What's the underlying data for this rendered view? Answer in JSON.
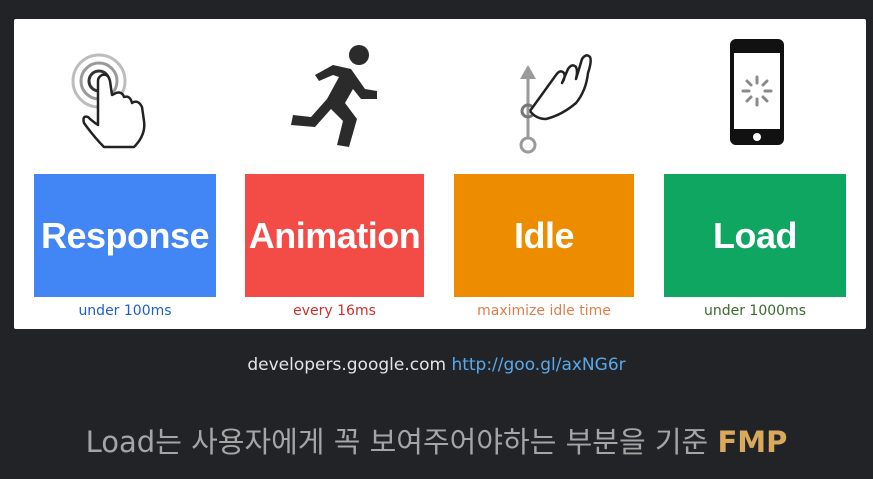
{
  "cards": [
    {
      "title": "Response",
      "subtitle": "under 100ms",
      "color": "#4286f5",
      "label_color": "#1f5fc4",
      "icon": "touch-hand-icon"
    },
    {
      "title": "Animation",
      "subtitle": "every 16ms",
      "color": "#f34b46",
      "label_color": "#cf2f2b",
      "icon": "running-person-icon"
    },
    {
      "title": "Idle",
      "subtitle": "maximize idle time",
      "color": "#ee8c00",
      "label_color": "#e07c4a",
      "icon": "swipe-up-icon"
    },
    {
      "title": "Load",
      "subtitle": "under 1000ms",
      "color": "#0fa661",
      "label_color": "#3a6a2e",
      "icon": "phone-loading-icon"
    }
  ],
  "source": {
    "site": "developers.google.com",
    "url": "http://goo.gl/axNG6r"
  },
  "caption": {
    "text": "Load는 사용자에게 꼭 보여주어야하는 부분을 기준",
    "highlight": "FMP"
  }
}
